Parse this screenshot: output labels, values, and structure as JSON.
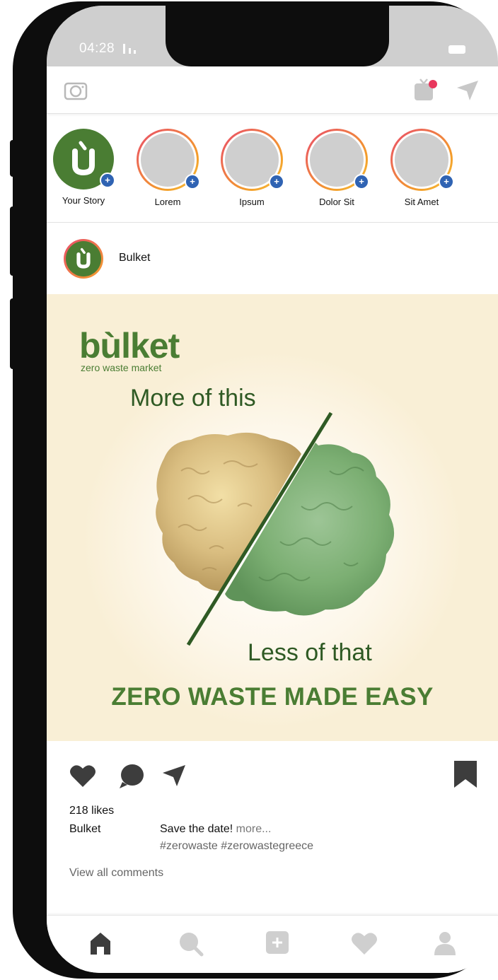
{
  "status": {
    "time": "04:28"
  },
  "stories": [
    {
      "label": "Your Story",
      "own": true
    },
    {
      "label": "Lorem"
    },
    {
      "label": "Ipsum"
    },
    {
      "label": "Dolor Sit"
    },
    {
      "label": "Sit Amet"
    }
  ],
  "post": {
    "username": "Bulket",
    "image": {
      "brand": "bùlket",
      "brand_sub": "zero waste market",
      "more_text": "More of this",
      "less_text": "Less of that",
      "tagline": "ZERO WASTE MADE EASY"
    },
    "likes": "218 likes",
    "caption_user": "Bulket",
    "caption": "Save the date!",
    "caption_more": "more...",
    "hashtags": "#zerowaste #zerowastegreece",
    "view_comments": "View all comments"
  },
  "icons": {
    "topbar": [
      "camera-icon",
      "igtv-icon",
      "direct-message-icon"
    ],
    "actions": [
      "like-heart-icon",
      "comment-icon",
      "share-icon",
      "bookmark-icon"
    ],
    "bottom_nav": [
      "home-icon",
      "search-icon",
      "add-post-icon",
      "activity-heart-icon",
      "profile-icon"
    ]
  },
  "colors": {
    "brand_green": "#4a7d33",
    "dark_green": "#2f5a24",
    "post_background": "#f9efd6",
    "story_plus": "#2f63b3",
    "notification_dot": "#e8375d"
  }
}
